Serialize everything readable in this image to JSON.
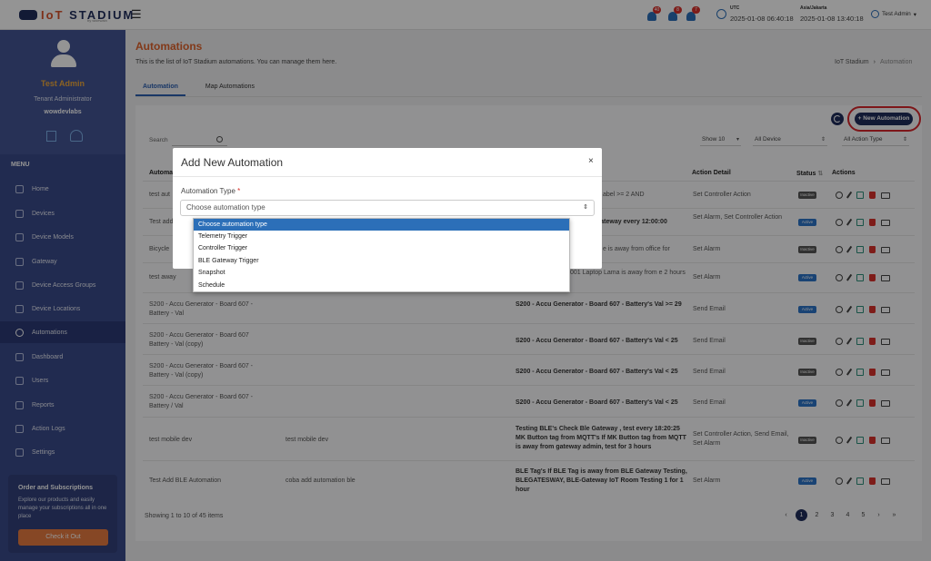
{
  "topbar": {
    "logo_prefix": "IoT",
    "logo_main": "STADIUM",
    "logo_sub": "by widewain",
    "notifications": [
      {
        "count": "40"
      },
      {
        "count": "8"
      },
      {
        "count": "7"
      }
    ],
    "tz1_label": "UTC",
    "tz1_time": "2025-01-08 06:40:18",
    "tz2_label": "Asia/Jakarta",
    "tz2_time": "2025-01-08 13:40:18",
    "user_label": "Test Admin"
  },
  "sidebar": {
    "name": "Test Admin",
    "role": "Tenant Administrator",
    "tenant": "wowdevlabs",
    "menu_label": "MENU",
    "items": [
      {
        "label": "Home"
      },
      {
        "label": "Devices"
      },
      {
        "label": "Device Models"
      },
      {
        "label": "Gateway"
      },
      {
        "label": "Device Access Groups"
      },
      {
        "label": "Device Locations"
      },
      {
        "label": "Automations"
      },
      {
        "label": "Dashboard"
      },
      {
        "label": "Users"
      },
      {
        "label": "Reports"
      },
      {
        "label": "Action Logs"
      },
      {
        "label": "Settings"
      }
    ],
    "promo": {
      "title": "Order and Subscriptions",
      "text": "Explore our products and easily manage your subscriptions all in one place",
      "button": "Check it Out"
    }
  },
  "main": {
    "title": "Automations",
    "subtitle": "This is the list of IoT Stadium automations. You can manage them here.",
    "breadcrumb": {
      "root": "IoT Stadium",
      "current": "Automation"
    },
    "tabs": [
      {
        "label": "Automation"
      },
      {
        "label": "Map Automations"
      }
    ],
    "new_button": "+ New Automation",
    "search_label": "Search",
    "filters": {
      "show": "Show 10",
      "device": "All Device",
      "action_type": "All Action Type"
    },
    "headers": {
      "name": "Automa",
      "action_detail": "Action Detail",
      "status": "Status",
      "actions": "Actions"
    },
    "rows": [
      {
        "name": "test aut",
        "desc": "",
        "trigger": "abel >= 2 AND",
        "action": "Set Controller Action",
        "status": "Inactive"
      },
      {
        "name": "Test add",
        "desc": "",
        "trigger": "e Gateway every 12:00:00",
        "action": "Set Alarm, Set Controller Action",
        "status": "Active"
      },
      {
        "name": "Bicycle",
        "desc": "",
        "trigger": "e is away from office for",
        "action": "Set Alarm",
        "status": "Inactive"
      },
      {
        "name": "test away",
        "desc": "",
        "trigger": "001 Laptop Lama is away from e 2 hours",
        "action": "Set Alarm",
        "status": "Active"
      },
      {
        "name": "S200 - Accu Generator - Board 607 - Battery - Val",
        "desc": "",
        "trigger": "S200 - Accu Generator - Board 607 - Battery's Val >= 29",
        "action": "Send Email",
        "status": "Active"
      },
      {
        "name": "S200 - Accu Generator - Board 607 Battery - Val (copy)",
        "desc": "",
        "trigger": "S200 - Accu Generator - Board 607 - Battery's Val < 25",
        "action": "Send Email",
        "status": "Inactive"
      },
      {
        "name": "S200 - Accu Generator - Board 607 - Battery - Val (copy)",
        "desc": "",
        "trigger": "S200 - Accu Generator - Board 607 - Battery's Val < 25",
        "action": "Send Email",
        "status": "Inactive"
      },
      {
        "name": "S200 - Accu Generator - Board 607 - Battery / Val",
        "desc": "",
        "trigger": "S200 - Accu Generator - Board 607 - Battery's Val < 25",
        "action": "Send Email",
        "status": "Active"
      },
      {
        "name": "test mobile dev",
        "desc": "test mobile dev",
        "trigger": "Testing BLE's Check Ble Gateway , test every 18:20:25 MK Button tag from MQTT's If MK Button tag from MQTT is away from gateway admin, test for 3 hours",
        "action": "Set Controller Action, Send Email, Set Alarm",
        "status": "Inactive"
      },
      {
        "name": "Test Add BLE Automation",
        "desc": "coba add automation ble",
        "trigger": "BLE Tag's If BLE Tag is away from BLE Gateway Testing, BLEGATESWAY, BLE-Gateway IoT Room Testing 1 for 1 hour",
        "action": "Set Alarm",
        "status": "Active"
      }
    ],
    "showing": "Showing 1 to 10 of 45 items",
    "pager": [
      "‹",
      "1",
      "2",
      "3",
      "4",
      "5",
      "›",
      "»"
    ]
  },
  "modal": {
    "title": "Add New Automation",
    "close": "×",
    "field_label": "Automation Type",
    "required_mark": "*",
    "placeholder": "Choose automation type",
    "options": [
      "Choose automation type",
      "Telemetry Trigger",
      "Controller Trigger",
      "BLE Gateway Trigger",
      "Snapshot",
      "Schedule"
    ]
  },
  "colors": {
    "accent": "#e0632c",
    "sidebar": "#3a4a8a",
    "primary": "#1f2d5c",
    "active_badge": "#2b74c8",
    "highlight": "#d8262c"
  }
}
